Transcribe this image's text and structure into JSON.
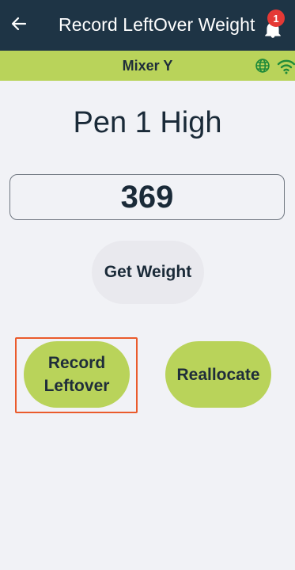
{
  "appbar": {
    "title": "Record LeftOver Weight",
    "back_icon": "arrow-left-icon",
    "notification_icon": "bell-icon",
    "notification_count": "1",
    "colors": {
      "background": "#1e3445",
      "badge": "#e53935"
    }
  },
  "subbar": {
    "title": "Mixer Y",
    "icons": [
      "globe-icon",
      "wifi-icon"
    ],
    "colors": {
      "background": "#b9d35a",
      "icon": "#1e8a3a"
    }
  },
  "main": {
    "pen_title": "Pen 1 High",
    "weight_value": "369",
    "get_weight_label": "Get Weight",
    "record_leftover_label": "Record Leftover",
    "reallocate_label": "Reallocate",
    "colors": {
      "accent": "#b9d35a",
      "highlight": "#ea5b2c"
    }
  }
}
